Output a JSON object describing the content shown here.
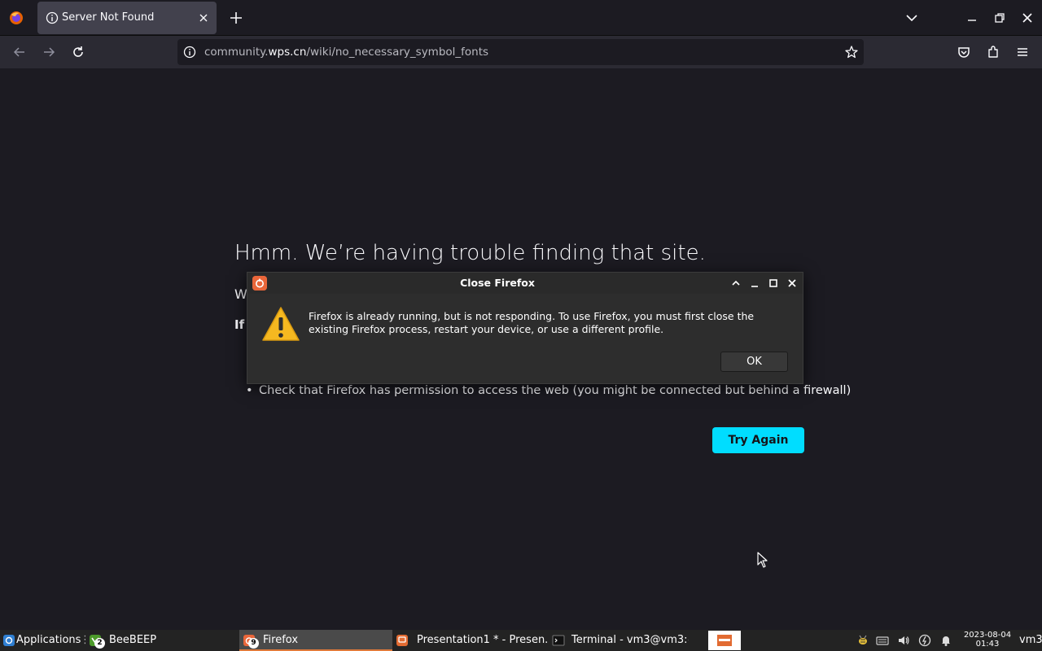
{
  "browser": {
    "tab_title": "Server Not Found",
    "url_prefix": "community.",
    "url_domain": "wps.cn",
    "url_path": "/wiki/no_necessary_symbol_fonts"
  },
  "page": {
    "title": "Hmm. We’re having trouble finding that site.",
    "frag1": "W",
    "frag2": "If",
    "bullet": "Check that Firefox has permission to access the web (you might be connected but behind a firewall)",
    "try_again": "Try Again"
  },
  "dialog": {
    "title": "Close Firefox",
    "message": "Firefox is already running, but is not responding. To use Firefox, you must first close the existing Firefox process, restart your device, or use a different profile.",
    "ok": "OK"
  },
  "taskbar": {
    "applications": "Applications",
    "beebeep": "BeeBEEP",
    "beebeep_badge": "2",
    "firefox": "Firefox",
    "firefox_badge": "9",
    "presentation": "Presentation1 * - Presen...",
    "terminal": "Terminal - vm3@vm3:~",
    "date": "2023-08-04",
    "time": "01:43",
    "user": "vm3"
  },
  "colors": {
    "accent": "#00ddff",
    "firefox_orange": "#e9663a",
    "warning_yellow": "#f5b820"
  }
}
